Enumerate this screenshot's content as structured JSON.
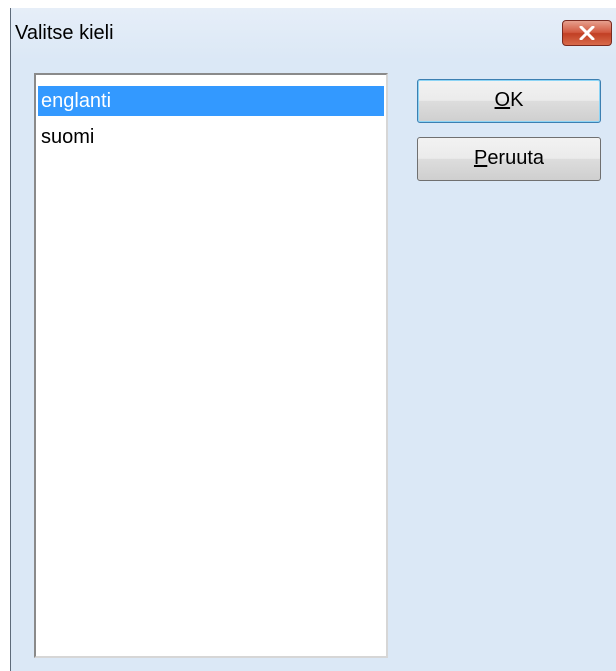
{
  "window": {
    "title": "Valitse kieli"
  },
  "list": {
    "items": [
      {
        "label": "englanti",
        "selected": true
      },
      {
        "label": "suomi",
        "selected": false
      }
    ]
  },
  "buttons": {
    "ok": {
      "accel": "O",
      "rest": "K"
    },
    "cancel": {
      "accel": "P",
      "rest": "eruuta"
    }
  },
  "icons": {
    "close": "close-icon"
  },
  "colors": {
    "selection": "#3399ff",
    "window_bg": "#dbe8f6",
    "close_button": "#c13f24"
  }
}
